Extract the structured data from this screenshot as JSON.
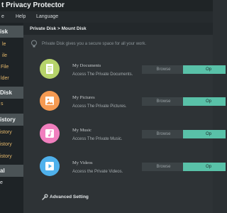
{
  "window": {
    "title": "t Privacy Protector"
  },
  "menu": {
    "items": [
      "e",
      "Help",
      "Language"
    ]
  },
  "sidebar": {
    "sections": [
      {
        "label": "isk",
        "items": [
          {
            "label": "le"
          },
          {
            "label": "ile"
          },
          {
            "label": "File"
          },
          {
            "label": "lder"
          }
        ]
      },
      {
        "label": "Disk",
        "items": [
          {
            "label": "s"
          }
        ]
      },
      {
        "label": "istory",
        "items": [
          {
            "label": "istory"
          },
          {
            "label": "istory"
          },
          {
            "label": "istory"
          }
        ]
      },
      {
        "label": "al",
        "items": [
          {
            "label": "e"
          }
        ]
      }
    ]
  },
  "main": {
    "breadcrumb": "Private Disk > Mount Disk",
    "info_text": "Private Disk gives you a secure space for all your work.",
    "items": [
      {
        "title": "My Documents",
        "desc": "Access The Private Documents.",
        "browse": "Browse",
        "open": "Op",
        "color": "#b6d36a",
        "icon": "document-icon"
      },
      {
        "title": "My Pictures",
        "desc": "Access The Private Pictures.",
        "browse": "Browse",
        "open": "Op",
        "color": "#f59a52",
        "icon": "picture-icon"
      },
      {
        "title": "My Music",
        "desc": "Access The Private Music.",
        "browse": "Browse",
        "open": "Op",
        "color": "#f07fbe",
        "icon": "music-icon"
      },
      {
        "title": "My Videos",
        "desc": "Access the Private Videos.",
        "browse": "Browse",
        "open": "Op",
        "color": "#4fb1ec",
        "icon": "video-icon"
      }
    ],
    "advanced_label": "Advanced Setting"
  },
  "colors": {
    "accent": "#59c1a8",
    "sidebar_accent_text": "#e6b96b"
  }
}
